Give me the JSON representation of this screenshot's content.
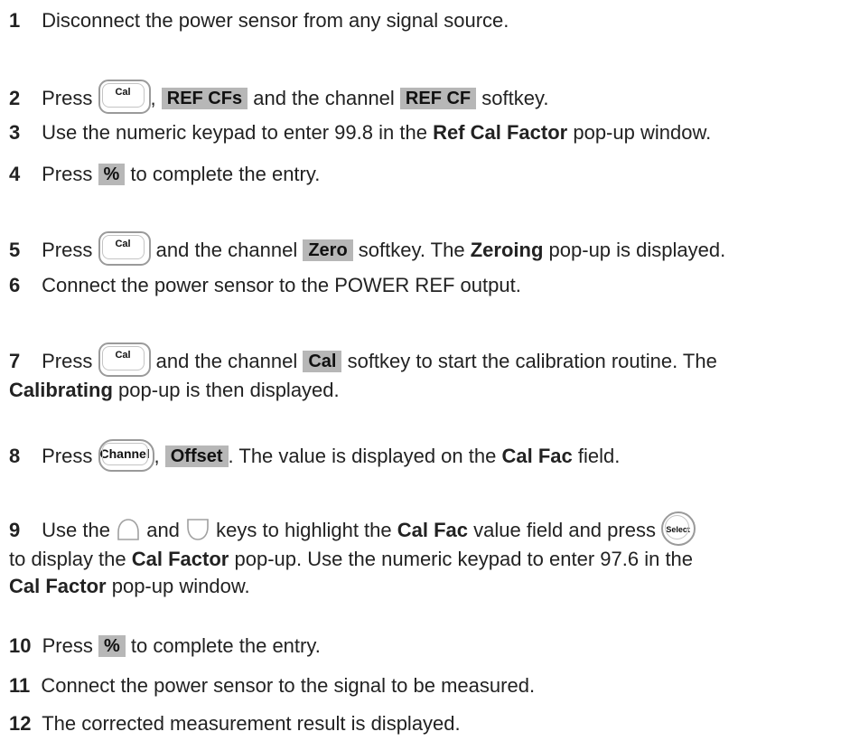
{
  "steps": [
    {
      "n": "1",
      "text": "Disconnect the power sensor from any signal source."
    },
    {
      "n": "2",
      "a": "Press",
      "key": "Cal",
      "b": ",",
      "sk1": "REF CFs",
      "c": "and the channel",
      "sk2": "REF CF",
      "d": "softkey."
    },
    {
      "n": "3",
      "a": "Use the numeric keypad to enter 99.8 in the",
      "bold": "Ref Cal Factor",
      "b": "pop-up window."
    },
    {
      "n": "4",
      "a": "Press",
      "sk": "%",
      "b": "to complete the entry."
    },
    {
      "n": "5",
      "a": "Press",
      "key": "Cal",
      "b": "and the channel",
      "sk": "Zero",
      "c": "softkey. The",
      "bold": "Zeroing",
      "d": "pop-up is displayed."
    },
    {
      "n": "6",
      "text": "Connect the power sensor to the POWER REF output."
    },
    {
      "n": "7",
      "a": "Press",
      "key": "Cal",
      "b": "and the channel",
      "sk": "Cal",
      "c": "softkey to start the calibration routine. The",
      "bold": "Calibrating",
      "d": "pop-up is then displayed."
    },
    {
      "n": "8",
      "a": "Press",
      "key": "Channel",
      "b": ",",
      "sk": "Offset",
      "c": ". The value is displayed on the",
      "bold": "Cal Fac",
      "d": "field."
    },
    {
      "n": "9",
      "a": "Use the",
      "b": "and",
      "c": "keys to highlight the",
      "bold1": "Cal Fac",
      "d": "value field and press",
      "key": "Select",
      "e": "to display the",
      "bold2": "Cal Factor",
      "f": "pop-up. Use the numeric keypad to enter 97.6 in the",
      "bold3": "Cal Factor",
      "g": "pop-up window."
    },
    {
      "n": "10",
      "a": "Press",
      "sk": "%",
      "b": "to complete the entry."
    },
    {
      "n": "11",
      "text": "Connect the power sensor to the signal to be measured."
    },
    {
      "n": "12",
      "text": "The corrected measurement result is displayed."
    }
  ]
}
